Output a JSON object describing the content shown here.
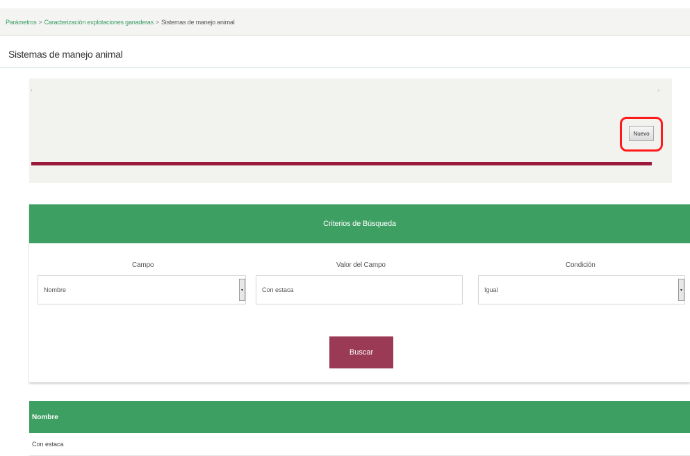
{
  "breadcrumb": {
    "items": [
      "Parámetros",
      "Caracterización explotaciones ganaderas"
    ],
    "separator": ">",
    "current": "Sistemas de manejo animal"
  },
  "page": {
    "title": "Sistemas de manejo animal"
  },
  "actions": {
    "new_label": "Nuevo"
  },
  "search": {
    "header": "Criterios de Búsqueda",
    "field_label": "Campo",
    "field_value": "Nombre",
    "value_label": "Valor del Campo",
    "value_value": "Con estaca",
    "condition_label": "Condición",
    "condition_value": "Igual",
    "search_label": "Buscar"
  },
  "results": {
    "columns": [
      "Nombre"
    ],
    "rows": [
      [
        "Con estaca"
      ]
    ]
  },
  "colors": {
    "green": "#3e9f63",
    "maroon": "#9b3a55",
    "highlight": "#ff1a1a"
  }
}
